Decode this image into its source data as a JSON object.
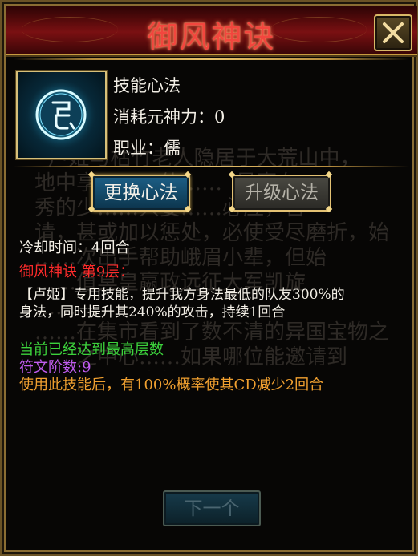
{
  "dialog": {
    "title": "御风神诀",
    "close_label": "关闭"
  },
  "skill": {
    "icon": "rune-skill-icon",
    "type_label": "技能心法",
    "cost_label": "消耗元神力：0",
    "class_label": "职业：儒"
  },
  "buttons": {
    "change": "更换心法",
    "upgrade": "升级心法",
    "next": "下一个"
  },
  "details": {
    "cooldown": "冷却时间：4回合",
    "level": "御风神诀 第9层：",
    "desc_line1": "【卢姬】专用技能，提升我方身法最低的队友300%的",
    "desc_line2": "身法，同时提升其240%的攻击，持续1回合",
    "max_level": "当前已经达到最高层数",
    "rune_level": "符文阶数:9",
    "effect": "使用此技能后，有100%概率使其CD减少2回合"
  },
  "background_text": "  卢姬与枯竹老人隐居于大荒山中，\n地中享……二仙……  最喜有\n秀的少……只要……必应，否\n请，甚或加以惩处，必使受尽磨折，始\n……次出手帮助峨眉小辈，但始\n……值冥皇嬴政远征大军凯旋\n……\n……在集市看到了数不清的异国宝物之\n……之中心……如果哪位能邀请到\n……得到很大的助力吧",
  "colors": {
    "title": "#f2463e",
    "white_text": "#f3efe6",
    "level_red": "#ff2b2b",
    "max_green": "#3cd23c",
    "rune_purple": "#c05cf0",
    "effect_orange": "#f0a030",
    "gold_border": "#e3c173"
  }
}
